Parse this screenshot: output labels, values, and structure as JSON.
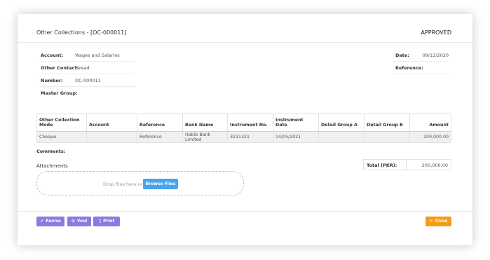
{
  "header": {
    "title": "Other Collections - [OC-000011]",
    "status": "APPROVED"
  },
  "fields": {
    "account_label": "Account:",
    "account_value": "Wages and Salaries",
    "other_contact_label": "Other Contact:",
    "other_contact_value": "Fawad",
    "number_label": "Number:",
    "number_value": "OC-000011",
    "master_group_label": "Master Group:",
    "master_group_value": "",
    "date_label": "Date:",
    "date_value": "09/12/2020",
    "reference_label": "Reference:",
    "reference_value": ""
  },
  "table": {
    "headers": {
      "mode": "Other Collection Mode",
      "account": "Account",
      "reference": "Reference",
      "bank_name": "Bank Name",
      "instrument_no": "Instrument No.",
      "instrument_date": "Instrument Date",
      "detail_a": "Detail Group A",
      "detail_b": "Detail Group B",
      "amount": "Amount"
    },
    "rows": [
      {
        "mode": "Cheque",
        "account": "",
        "reference": "Reference",
        "bank_name": "Habib Bank Limited",
        "instrument_no": "3231321",
        "instrument_date": "14/05/2021",
        "detail_a": "",
        "detail_b": "",
        "amount": "200,000.00"
      }
    ]
  },
  "comments_label": "Comments:",
  "attachments": {
    "label": "Attachments",
    "drop_text": "Drop files here or",
    "browse_label": "Browse Files"
  },
  "total": {
    "label": "Total (PKR):",
    "value": "200,000.00"
  },
  "actions": {
    "revise": "Revise",
    "void": "Void",
    "print": "Print",
    "close": "Close"
  },
  "colors": {
    "action_purple": "#8b7ae0",
    "close_orange": "#f59c1a",
    "browse_blue": "#4aa3ec"
  }
}
